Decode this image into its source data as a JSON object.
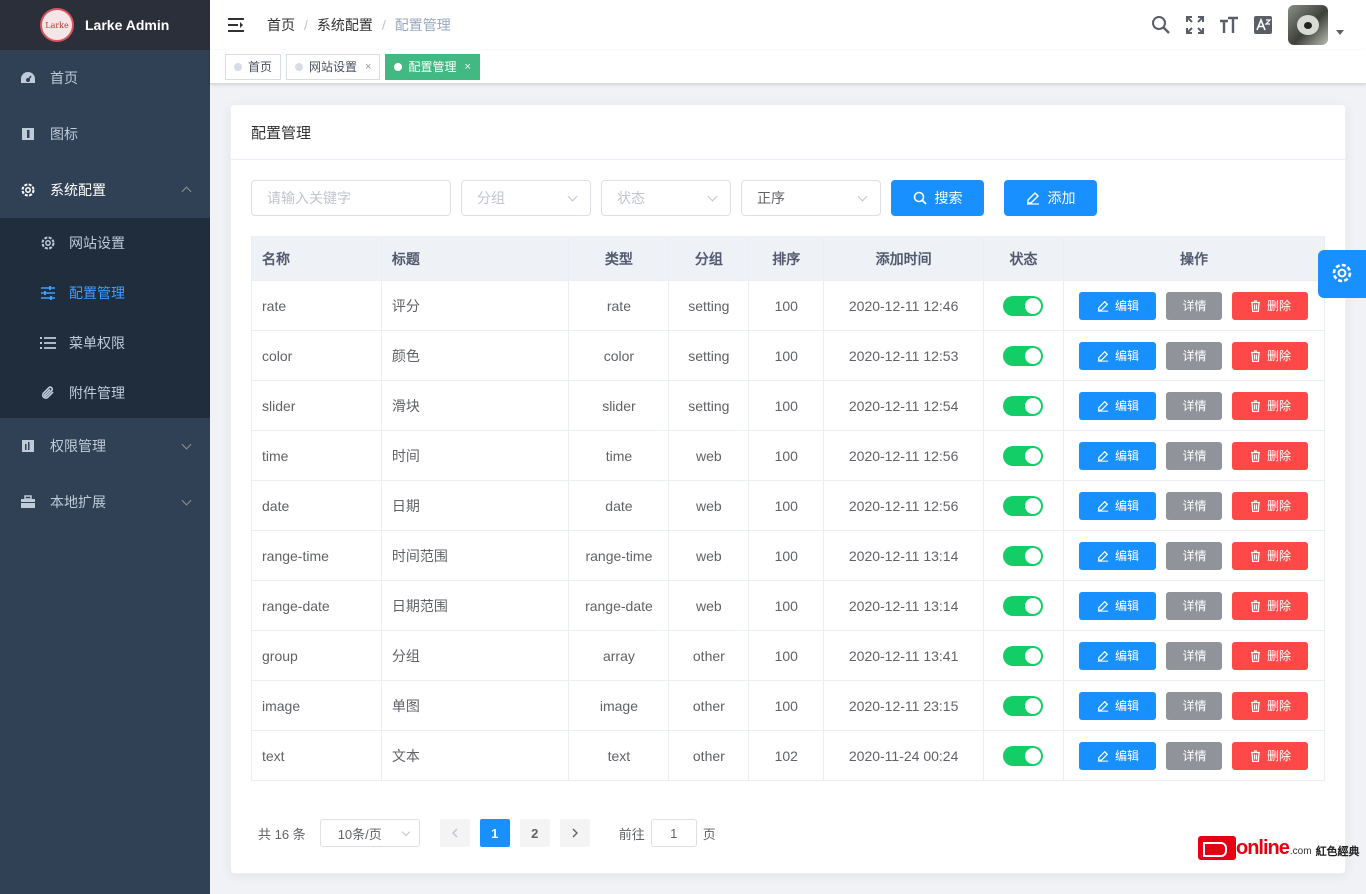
{
  "app": {
    "name": "Larke Admin",
    "logo_text": "Larke"
  },
  "sidebar": {
    "items": [
      {
        "label": "首页",
        "icon": "dashboard-icon"
      },
      {
        "label": "图标",
        "icon": "info-icon"
      },
      {
        "label": "系统配置",
        "icon": "gear-icon",
        "expanded": true,
        "children": [
          {
            "label": "网站设置",
            "icon": "gear-icon"
          },
          {
            "label": "配置管理",
            "icon": "sliders-icon",
            "active": true
          },
          {
            "label": "菜单权限",
            "icon": "list-icon"
          },
          {
            "label": "附件管理",
            "icon": "paperclip-icon"
          }
        ]
      },
      {
        "label": "权限管理",
        "icon": "chart-icon"
      },
      {
        "label": "本地扩展",
        "icon": "briefcase-icon"
      }
    ]
  },
  "breadcrumb": [
    "首页",
    "系统配置",
    "配置管理"
  ],
  "tags": [
    {
      "label": "首页",
      "closable": false,
      "active": false
    },
    {
      "label": "网站设置",
      "closable": true,
      "active": false
    },
    {
      "label": "配置管理",
      "closable": true,
      "active": true
    }
  ],
  "card": {
    "title": "配置管理"
  },
  "filters": {
    "keyword_placeholder": "请输入关键字",
    "group_placeholder": "分组",
    "status_placeholder": "状态",
    "order_value": "正序",
    "search_label": "搜索",
    "add_label": "添加"
  },
  "table": {
    "columns": [
      "名称",
      "标题",
      "类型",
      "分组",
      "排序",
      "添加时间",
      "状态",
      "操作"
    ],
    "rows": [
      {
        "name": "rate",
        "title": "评分",
        "type": "rate",
        "group": "setting",
        "sort": "100",
        "time": "2020-12-11 12:46",
        "status": true
      },
      {
        "name": "color",
        "title": "颜色",
        "type": "color",
        "group": "setting",
        "sort": "100",
        "time": "2020-12-11 12:53",
        "status": true
      },
      {
        "name": "slider",
        "title": "滑块",
        "type": "slider",
        "group": "setting",
        "sort": "100",
        "time": "2020-12-11 12:54",
        "status": true
      },
      {
        "name": "time",
        "title": "时间",
        "type": "time",
        "group": "web",
        "sort": "100",
        "time": "2020-12-11 12:56",
        "status": true
      },
      {
        "name": "date",
        "title": "日期",
        "type": "date",
        "group": "web",
        "sort": "100",
        "time": "2020-12-11 12:56",
        "status": true
      },
      {
        "name": "range-time",
        "title": "时间范围",
        "type": "range-time",
        "group": "web",
        "sort": "100",
        "time": "2020-12-11 13:14",
        "status": true
      },
      {
        "name": "range-date",
        "title": "日期范围",
        "type": "range-date",
        "group": "web",
        "sort": "100",
        "time": "2020-12-11 13:14",
        "status": true
      },
      {
        "name": "group",
        "title": "分组",
        "type": "array",
        "group": "other",
        "sort": "100",
        "time": "2020-12-11 13:41",
        "status": true
      },
      {
        "name": "image",
        "title": "单图",
        "type": "image",
        "group": "other",
        "sort": "100",
        "time": "2020-12-11 23:15",
        "status": true
      },
      {
        "name": "text",
        "title": "文本",
        "type": "text",
        "group": "other",
        "sort": "102",
        "time": "2020-11-24 00:24",
        "status": true
      }
    ],
    "actions": {
      "edit": "编辑",
      "detail": "详情",
      "delete": "删除"
    }
  },
  "pagination": {
    "total_text": "共 16 条",
    "page_size": "10条/页",
    "pages": [
      "1",
      "2"
    ],
    "current": "1",
    "goto_prefix": "前往",
    "goto_value": "1",
    "goto_suffix": "页"
  },
  "watermark": {
    "brand": "online",
    "domain": ".com",
    "cn": "紅色經典"
  },
  "colors": {
    "primary": "#1890ff",
    "sidebar": "#304156",
    "success": "#13ce66",
    "danger": "#ff4949",
    "info": "#909399",
    "tag_active": "#42b983"
  }
}
